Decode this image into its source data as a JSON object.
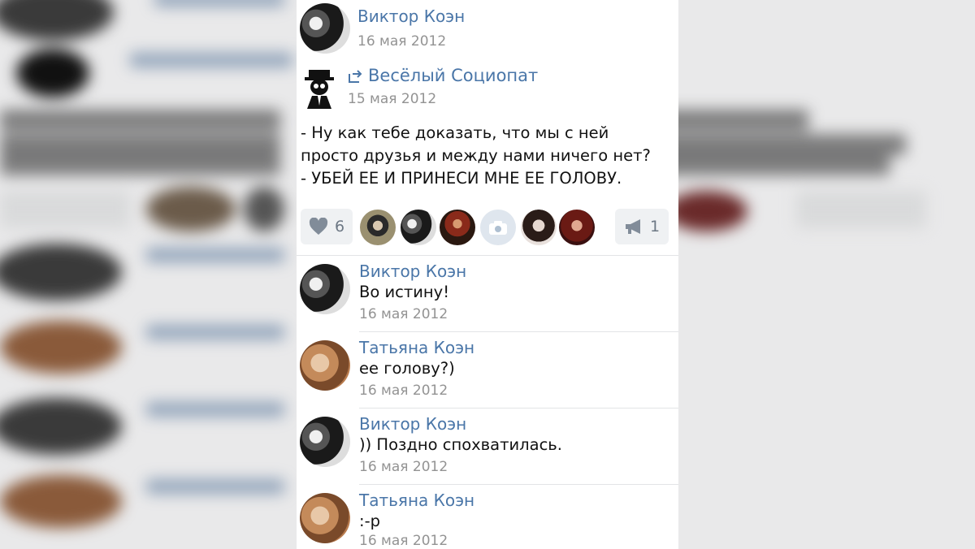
{
  "post": {
    "author_name": "Виктор Коэн",
    "author_date": "16 мая 2012",
    "repost_from_name": "Весёлый Социопат",
    "repost_date": "15 мая 2012",
    "text_lines": [
      "- Ну как тебе доказать, что мы с ней",
      "просто друзья и между нами ничего нет?",
      "- УБЕЙ ЕЕ И ПРИНЕСИ МНЕ ЕЕ ГОЛОВУ."
    ],
    "likes_count": "6",
    "shares_count": "1",
    "icons": {
      "like": "heart-icon",
      "share": "megaphone-icon",
      "repost": "repost-arrow-icon",
      "camera": "camera-icon"
    }
  },
  "comments": [
    {
      "name": "Виктор Коэн",
      "text": "Во истину!",
      "date": "16 мая 2012"
    },
    {
      "name": "Татьяна Коэн",
      "text": "ее голову?)",
      "date": "16 мая 2012"
    },
    {
      "name": "Виктор Коэн",
      "text": ")) Поздно спохватилась.",
      "date": "16 мая 2012"
    },
    {
      "name": "Татьяна Коэн",
      "text": ":-р",
      "date": "16 мая 2012"
    }
  ],
  "colors": {
    "link": "#4a76a8",
    "date": "#939393",
    "text": "#111111",
    "action_bg": "#eff1f3"
  }
}
